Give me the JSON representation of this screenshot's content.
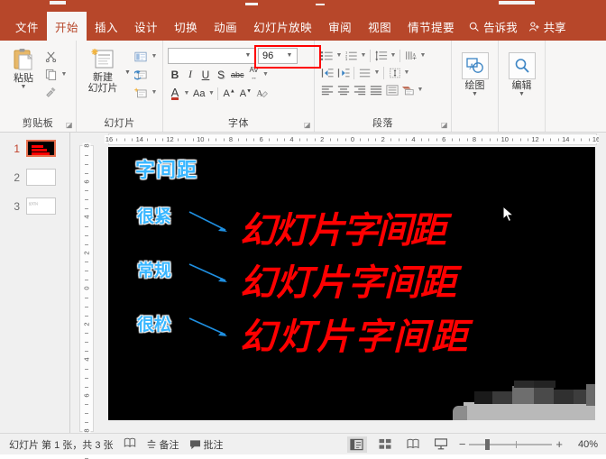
{
  "window": {
    "app": "PowerPoint"
  },
  "ribbon": {
    "tabs": [
      {
        "label": "文件",
        "active": false
      },
      {
        "label": "开始",
        "active": true
      },
      {
        "label": "插入",
        "active": false
      },
      {
        "label": "设计",
        "active": false
      },
      {
        "label": "切换",
        "active": false
      },
      {
        "label": "动画",
        "active": false
      },
      {
        "label": "幻灯片放映",
        "active": false
      },
      {
        "label": "审阅",
        "active": false
      },
      {
        "label": "视图",
        "active": false
      },
      {
        "label": "情节提要",
        "active": false
      }
    ],
    "tell_me": {
      "label": "告诉我",
      "icon": "search-icon"
    },
    "share": {
      "label": "共享",
      "icon": "person-add-icon"
    },
    "groups": {
      "clipboard": {
        "label": "剪贴板",
        "paste_label": "粘贴",
        "cut_icon": "scissors-icon",
        "copy_icon": "copy-icon",
        "format_painter_icon": "format-painter-icon",
        "dialog_launcher": "dialog-launcher-icon"
      },
      "slides": {
        "label": "幻灯片",
        "new_slide_label": "新建\n幻灯片",
        "layout_icon": "layout-icon",
        "reset_icon": "reset-icon",
        "section_icon": "section-icon"
      },
      "font": {
        "label": "字体",
        "font_name_value": "",
        "font_name_placeholder": "",
        "font_size_value": "96",
        "bold": "B",
        "italic": "I",
        "underline": "U",
        "shadow": "S",
        "strikethrough": "abc",
        "char_spacing_icon": "AV",
        "font_color_icon": "A",
        "change_case_icon": "Aa",
        "increase_size_icon": "A-up-icon",
        "decrease_size_icon": "A-down-icon",
        "clear_format_icon": "clear-format-icon",
        "dialog_launcher": "dialog-launcher-icon",
        "highlight_color": "#ff0000"
      },
      "paragraph": {
        "label": "段落",
        "bullets_icon": "bullet-list-icon",
        "numbering_icon": "numbered-list-icon",
        "line_spacing_icon": "line-spacing-icon",
        "text_direction_icon": "text-direction-icon",
        "decrease_indent_icon": "decrease-indent-icon",
        "increase_indent_icon": "increase-indent-icon",
        "columns_icon": "columns-icon",
        "align_text_icon": "align-text-vertical-icon",
        "align_left_icon": "align-left-icon",
        "align_center_icon": "align-center-icon",
        "align_right_icon": "align-right-icon",
        "justify_icon": "justify-icon",
        "convert_smartart_icon": "smartart-icon",
        "dialog_launcher": "dialog-launcher-icon"
      },
      "drawing": {
        "label": "绘图",
        "icon": "shapes-icon"
      },
      "editing": {
        "label": "编辑",
        "icon": "search-magnifier-icon"
      }
    }
  },
  "thumbnails": [
    {
      "number": "1",
      "selected": true,
      "preview_text": ""
    },
    {
      "number": "2",
      "selected": false,
      "preview_text": ""
    },
    {
      "number": "3",
      "selected": false,
      "preview_text": "幻灯片"
    }
  ],
  "rulers": {
    "horizontal_ticks": [
      "16",
      "14",
      "12",
      "10",
      "8",
      "6",
      "4",
      "2",
      "0",
      "2",
      "4",
      "6",
      "8",
      "10",
      "12",
      "14",
      "16"
    ],
    "vertical_ticks": [
      "8",
      "6",
      "4",
      "2",
      "0",
      "2",
      "4",
      "6",
      "8"
    ]
  },
  "slide": {
    "background_color": "#000000",
    "title": "字间距",
    "title_color": "#38b6ff",
    "text_color": "#ff0000",
    "rows": [
      {
        "label": "很紧",
        "text": "幻灯片字间距",
        "spacing": "-2.2px"
      },
      {
        "label": "常规",
        "text": "幻灯片字间距",
        "spacing": "0px"
      },
      {
        "label": "很松",
        "text": "幻灯片字间距",
        "spacing": "2.5px"
      }
    ]
  },
  "statusbar": {
    "slide_count_text": "幻灯片 第 1 张，共 3 张",
    "language_icon": "language-icon",
    "notes_label": "备注",
    "notes_icon": "notes-icon",
    "comments_label": "批注",
    "comments_icon": "comment-icon",
    "views": [
      {
        "name": "normal-view",
        "active": true
      },
      {
        "name": "slide-sorter-view",
        "active": false
      },
      {
        "name": "reading-view",
        "active": false
      },
      {
        "name": "slideshow-view",
        "active": false
      }
    ],
    "zoom_out": "−",
    "zoom_in": "+",
    "zoom_value": "40%"
  }
}
